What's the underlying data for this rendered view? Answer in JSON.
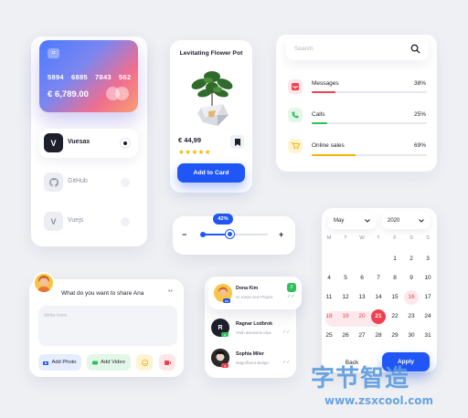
{
  "card": {
    "numbers": [
      "5894",
      "6885",
      "7843",
      "562"
    ],
    "balance": "€ 6,789.00",
    "accounts": [
      {
        "label": "Vuesax",
        "logo": "V",
        "selected": true
      },
      {
        "label": "GitHub",
        "logo": "github-icon",
        "selected": false
      },
      {
        "label": "Vuejs",
        "logo": "V",
        "selected": false
      }
    ]
  },
  "product": {
    "title": "Levitating Flower Pot",
    "price": "€ 44,99",
    "stars": "★★★★★",
    "rating": 4.5,
    "button": "Add to Card"
  },
  "search": {
    "placeholder": "Search"
  },
  "stats": [
    {
      "label": "Messages",
      "value": "38%",
      "percent": 38,
      "color": "#f0404f",
      "icon": "inbox-icon",
      "bg": "#fde6e8"
    },
    {
      "label": "Calls",
      "value": "25%",
      "percent": 25,
      "color": "#2fbf5c",
      "icon": "phone-icon",
      "bg": "#e3f7e9"
    },
    {
      "label": "Online sales",
      "value": "69%",
      "percent": 69,
      "color": "#f5b400",
      "icon": "cart-icon",
      "bg": "#fff3d6"
    }
  ],
  "slider": {
    "value_label": "42%",
    "value": 42,
    "minus": "−",
    "plus": "+"
  },
  "share": {
    "prompt": "What do you want to share Ana",
    "more": "••",
    "placeholder": "Write here",
    "actions": [
      {
        "label": "Add Photo",
        "icon": "camera-icon",
        "color": "#2056f5",
        "bg": "#e6edff"
      },
      {
        "label": "Add Video",
        "icon": "video-icon",
        "color": "#2fbf5c",
        "bg": "#e3f7e9"
      },
      {
        "label": "",
        "icon": "smile-icon",
        "color": "#f5b400",
        "bg": "#fff3d6"
      },
      {
        "label": "",
        "icon": "record-icon",
        "color": "#f0404f",
        "bg": "#fde6e8"
      }
    ]
  },
  "chats": [
    {
      "name": "Dona Kim",
      "message": "Hi Jonas new Project",
      "badge": "2",
      "initial": ""
    },
    {
      "name": "Ragnar Lodbrok",
      "message": "Yeah awesome idea",
      "badge": "",
      "initial": "R"
    },
    {
      "name": "Sophia Miler",
      "message": "Magnificent design",
      "badge": "",
      "initial": ""
    }
  ],
  "calendar": {
    "month": "May",
    "year": "2020",
    "weekdays": [
      "M",
      "T",
      "W",
      "T",
      "F",
      "S",
      "S"
    ],
    "weeks": [
      [
        "",
        "",
        "",
        "",
        "1",
        "2",
        "3"
      ],
      [
        "4",
        "5",
        "6",
        "7",
        "8",
        "9",
        "10"
      ],
      [
        "11",
        "12",
        "13",
        "14",
        "15",
        "16",
        "17"
      ],
      [
        "18",
        "19",
        "20",
        "21",
        "22",
        "23",
        "24"
      ],
      [
        "25",
        "26",
        "27",
        "28",
        "29",
        "30",
        "31"
      ]
    ],
    "selected_day": "21",
    "range_days": [
      "18",
      "19",
      "20",
      "21"
    ],
    "weekend_red": [
      "16"
    ],
    "back": "Back",
    "apply": "Apply"
  },
  "watermark": {
    "text": "字节智造",
    "url": "www.zsxcool.com"
  }
}
